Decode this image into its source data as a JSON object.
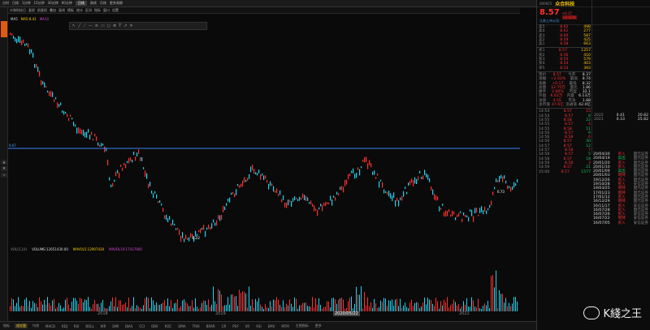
{
  "topbar": {
    "tabs": [
      "分时",
      "日线",
      "1分钟",
      "15分钟",
      "30分钟",
      "60分钟",
      "日线",
      "周线",
      "月线",
      "更多周期"
    ],
    "active_index": 6
  },
  "chartbar": {
    "items": [
      "众和科技日",
      "复权",
      "前复权",
      "叠加",
      "画线",
      "模板",
      "统计",
      "区间",
      "指标",
      "窗口",
      "设置"
    ]
  },
  "indicator": {
    "name": "MA5",
    "value": "MA5:8.41",
    "label2": "MA10"
  },
  "price_line": {
    "label": "9.67"
  },
  "chart_labels": {
    "high_label": "7.32",
    "low_label": "4.22",
    "mid_label": "6.73"
  },
  "volume": {
    "title": "VOL(5,10)",
    "vol_label": "VOLUME:12651430.00",
    "ma5_label": "MAVOL5:12907430",
    "ma10_label": "MAVOL10:17417900"
  },
  "dates": [
    "2018",
    "2019",
    "2020/05/22",
    "2021"
  ],
  "bottom_tabs": [
    "指标",
    "成交量",
    "均线",
    "MACD",
    "KDJ",
    "RSI",
    "BOLL",
    "WR",
    "DMI",
    "BIAS",
    "CCI",
    "OBV",
    "ROC",
    "DMA",
    "TRIX",
    "BRAR",
    "CR",
    "PSY",
    "VR",
    "ASI",
    "EMV",
    "MTM",
    "主图指标",
    "更多"
  ],
  "bottom_active": 1,
  "stock": {
    "code": "000925",
    "name": "众合科技",
    "price": "8.57",
    "change": "+0.17",
    "pct": "+2.02%",
    "tag": "江苏上市公司"
  },
  "orderbook": {
    "sell": [
      {
        "label": "卖5",
        "price": "8.62",
        "vol": "498"
      },
      {
        "label": "卖4",
        "price": "8.61",
        "vol": "277"
      },
      {
        "label": "卖3",
        "price": "8.60",
        "vol": "587"
      },
      {
        "label": "卖2",
        "price": "8.59",
        "vol": "425"
      },
      {
        "label": "卖1",
        "price": "8.58",
        "vol": "663"
      }
    ],
    "buy": [
      {
        "label": "买1",
        "price": "8.57",
        "vol": "1257"
      },
      {
        "label": "买2",
        "price": "8.56",
        "vol": "410"
      },
      {
        "label": "买3",
        "price": "8.55",
        "vol": "579"
      },
      {
        "label": "买4",
        "price": "8.54",
        "vol": "403"
      },
      {
        "label": "买5",
        "price": "8.53",
        "vol": "393"
      }
    ]
  },
  "stats": [
    {
      "k": "现价",
      "v": "8.57",
      "k2": "今开",
      "v2": "8.37"
    },
    {
      "k": "涨幅",
      "v": "+2.02%",
      "k2": "最高",
      "v2": "8.74"
    },
    {
      "k": "涨跌",
      "v": "+0.17",
      "k2": "最低",
      "v2": "8.32"
    },
    {
      "k": "总量",
      "v": "12.75万",
      "k2": "量比",
      "v2": "1.86"
    },
    {
      "k": "换手",
      "v": "2.60%",
      "k2": "市盈",
      "v2": "32.1"
    },
    {
      "k": "外盘",
      "v": "6.62万",
      "k2": "内盘",
      "v2": "6.13万"
    },
    {
      "k": "净资",
      "v": "4.55",
      "k2": "市净",
      "v2": "1.88"
    },
    {
      "k": "总市值",
      "v": "47.6亿",
      "k2": "流通值",
      "v2": "42.0亿"
    }
  ],
  "ticks": [
    {
      "t": "14:54",
      "p": "8.57",
      "v": "15"
    },
    {
      "t": "14:54",
      "p": "8.57",
      "v": "8"
    },
    {
      "t": "14:55",
      "p": "8.58",
      "v": "22"
    },
    {
      "t": "14:55",
      "p": "8.57",
      "v": "4"
    },
    {
      "t": "14:55",
      "p": "8.58",
      "v": "11"
    },
    {
      "t": "14:56",
      "p": "8.57",
      "v": "9"
    },
    {
      "t": "14:56",
      "p": "8.58",
      "v": "6"
    },
    {
      "t": "14:56",
      "p": "8.57",
      "v": "30"
    },
    {
      "t": "14:57",
      "p": "8.57",
      "v": "12"
    },
    {
      "t": "14:57",
      "p": "8.58",
      "v": "7"
    },
    {
      "t": "14:58",
      "p": "8.57",
      "v": "5"
    },
    {
      "t": "14:58",
      "p": "8.57",
      "v": "18"
    },
    {
      "t": "14:59",
      "p": "8.58",
      "v": "3"
    },
    {
      "t": "14:59",
      "p": "8.57",
      "v": "21"
    },
    {
      "t": "15:00",
      "p": "8.57",
      "v": "1577"
    }
  ],
  "deals": [
    {
      "d": "20/04/30",
      "a": "买入",
      "b": "国元证券"
    },
    {
      "d": "20/04/19",
      "a": "卖出",
      "b": "国元证券"
    },
    {
      "d": "20/01/20",
      "a": "买入",
      "b": "国元证券"
    },
    {
      "d": "20/01/10",
      "a": "买入",
      "b": "国元证券"
    },
    {
      "d": "20/01/09",
      "a": "卖出",
      "b": "国元证券"
    },
    {
      "d": "20/01/03",
      "a": "增持",
      "b": "国元证券"
    },
    {
      "d": "19/12/26",
      "a": "买入",
      "b": "国元证券"
    },
    {
      "d": "19/10/28",
      "a": "买入",
      "b": "安信证券"
    },
    {
      "d": "19/03/25",
      "a": "增持",
      "b": "国元证券"
    },
    {
      "d": "17/01/23",
      "a": "增持",
      "b": "国元证券"
    },
    {
      "d": "17/01/12",
      "a": "买入",
      "b": "国元证券"
    },
    {
      "d": "16/12/29",
      "a": "增持",
      "b": "国元证券"
    },
    {
      "d": "16/11/17",
      "a": "买入",
      "b": "安信证券"
    },
    {
      "d": "16/07/28",
      "a": "买入",
      "b": "国元证券"
    },
    {
      "d": "16/07/26",
      "a": "买入",
      "b": "安信证券"
    },
    {
      "d": "16/07/22",
      "a": "增持",
      "b": "安信证券"
    },
    {
      "d": "16/07/05",
      "a": "买入",
      "b": "安信证券"
    }
  ],
  "years": [
    {
      "y": "2022",
      "a": "0.41",
      "b": "20.82"
    },
    {
      "y": "2021",
      "a": "0.33",
      "b": "25.82"
    }
  ],
  "watermark": {
    "text": "K綫之王"
  },
  "colors": {
    "up": "#ff3030",
    "down": "#22c55e",
    "accent": "#e05a10",
    "line": "#3b82f6"
  }
}
